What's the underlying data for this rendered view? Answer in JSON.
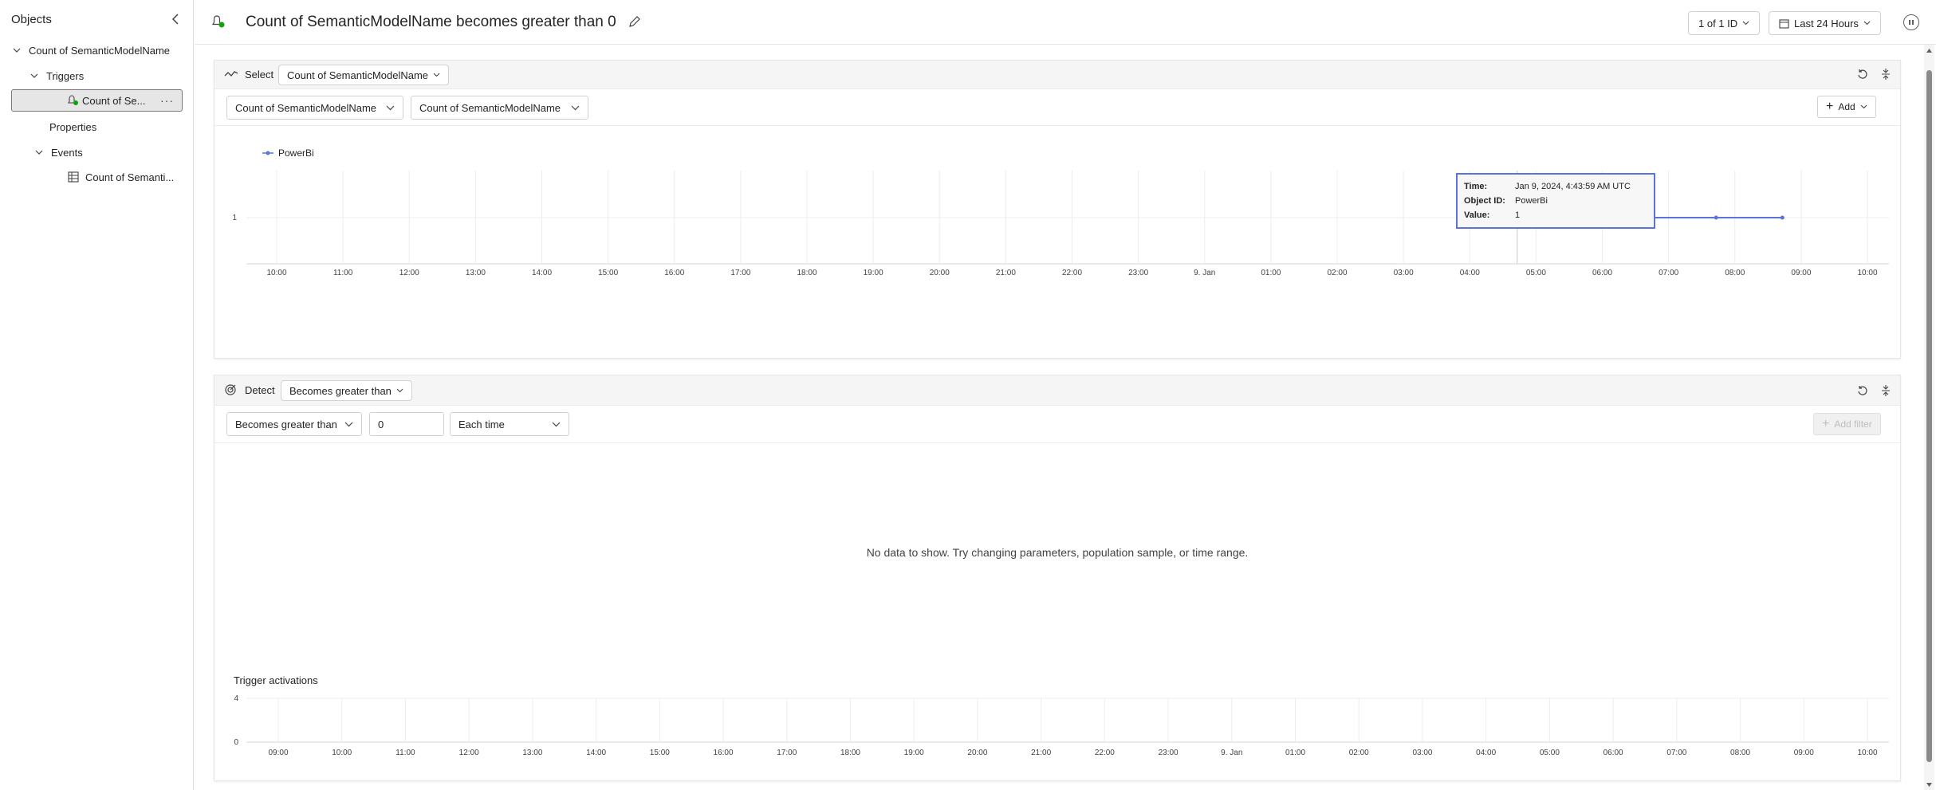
{
  "sidebar": {
    "title": "Objects",
    "items": [
      {
        "label": "Count of SemanticModelName"
      },
      {
        "label": "Triggers"
      },
      {
        "label": "Count of Se..."
      },
      {
        "label": "Properties"
      },
      {
        "label": "Events"
      },
      {
        "label": "Count of Semanti..."
      }
    ]
  },
  "header": {
    "title": "Count of SemanticModelName becomes greater than 0",
    "id_selector": "1 of 1 ID",
    "time_range": "Last 24 Hours"
  },
  "select_card": {
    "label": "Select",
    "selector": "Count of SemanticModelName",
    "field1": "Count of SemanticModelName",
    "field2": "Count of SemanticModelName",
    "add_label": "Add",
    "legend": "PowerBi",
    "tooltip": {
      "time_key": "Time:",
      "time_val": "Jan 9, 2024, 4:43:59 AM UTC",
      "obj_key": "Object ID:",
      "obj_val": "PowerBi",
      "val_key": "Value:",
      "val_val": "1"
    }
  },
  "detect_card": {
    "label": "Detect",
    "selector": "Becomes greater than",
    "condition": "Becomes greater than",
    "value": "0",
    "frequency": "Each time",
    "add_filter": "Add filter",
    "empty": "No data to show. Try changing parameters, population sample, or time range.",
    "activations_label": "Trigger activations"
  },
  "chart_data": [
    {
      "type": "line",
      "x_ticks": [
        "10:00",
        "11:00",
        "12:00",
        "13:00",
        "14:00",
        "15:00",
        "16:00",
        "17:00",
        "18:00",
        "19:00",
        "20:00",
        "21:00",
        "22:00",
        "23:00",
        "9. Jan",
        "01:00",
        "02:00",
        "03:00",
        "04:00",
        "05:00",
        "06:00",
        "07:00",
        "08:00",
        "09:00",
        "10:00"
      ],
      "y_ticks": [
        "1"
      ],
      "series": [
        {
          "name": "PowerBi",
          "x": [
            "04:43",
            "05:43",
            "06:43",
            "07:43",
            "08:43"
          ],
          "values": [
            1,
            1,
            1,
            1,
            1
          ]
        }
      ],
      "color": "#5b74db",
      "grid": true,
      "legend": "top-left"
    },
    {
      "type": "bar",
      "title": "Trigger activations",
      "x_ticks": [
        "09:00",
        "10:00",
        "11:00",
        "12:00",
        "13:00",
        "14:00",
        "15:00",
        "16:00",
        "17:00",
        "18:00",
        "19:00",
        "20:00",
        "21:00",
        "22:00",
        "23:00",
        "9. Jan",
        "01:00",
        "02:00",
        "03:00",
        "04:00",
        "05:00",
        "06:00",
        "07:00",
        "08:00",
        "09:00",
        "10:00"
      ],
      "y_ticks": [
        "4",
        "0"
      ],
      "ylim": [
        0,
        4
      ],
      "values": [],
      "grid": true
    }
  ]
}
